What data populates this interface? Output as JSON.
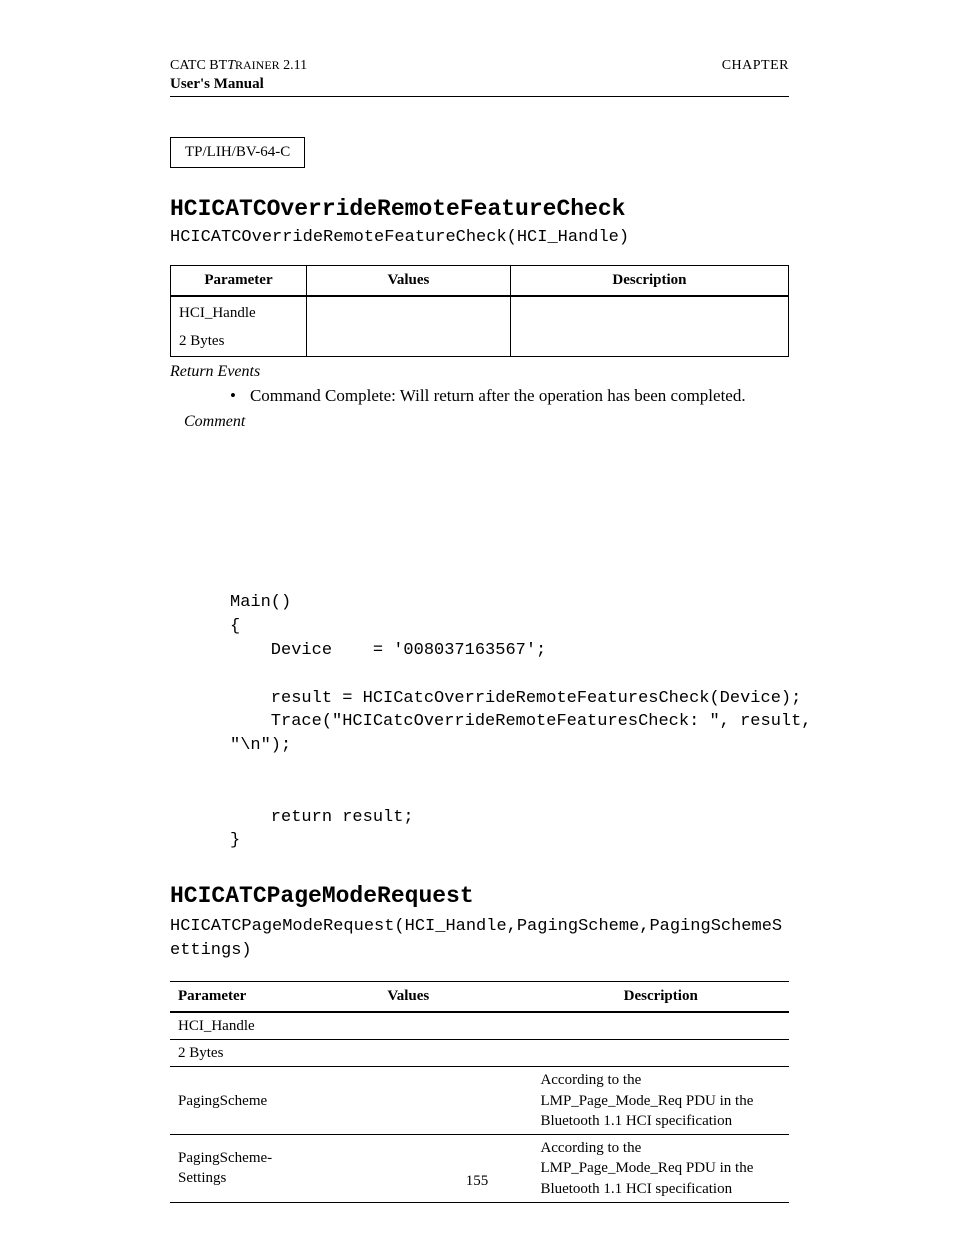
{
  "header": {
    "left_prefix": "CATC BT",
    "left_italic": "T",
    "left_smallcaps": "RAINER",
    "left_version": " 2.11",
    "right": "CHAPTER",
    "manual": "User's Manual"
  },
  "boxed_ref": "TP/LIH/BV-64-C",
  "section1": {
    "heading": "HCICATCOverrideRemoteFeatureCheck",
    "signature": "HCICATCOverrideRemoteFeatureCheck(HCI_Handle)",
    "table": {
      "headers": {
        "p": "Parameter",
        "v": "Values",
        "d": "Description"
      },
      "rows": [
        {
          "p": "HCI_Handle",
          "v": "",
          "d": ""
        },
        {
          "p": "2 Bytes",
          "v": "",
          "d": ""
        }
      ]
    },
    "return_label": "Return Events",
    "bullet": "Command Complete:  Will return after the operation has been completed.",
    "comment_label": "Comment",
    "code": "Main()\n{\n    Device    = '008037163567';\n\n    result = HCICatcOverrideRemoteFeaturesCheck(Device);\n    Trace(\"HCICatcOverrideRemoteFeaturesCheck: \", result, \n\"\\n\");\n\n\n    return result;\n}"
  },
  "section2": {
    "heading": "HCICATCPageModeRequest",
    "signature": "HCICATCPageModeRequest(HCI_Handle,PagingScheme,PagingSchemeSettings)",
    "table": {
      "headers": {
        "p": "Parameter",
        "v": "Values",
        "d": "Description"
      },
      "rows": [
        {
          "p": "HCI_Handle",
          "v": "",
          "d": ""
        },
        {
          "p": "2 Bytes",
          "v": "",
          "d": ""
        },
        {
          "p": "PagingScheme",
          "v": "",
          "d": "According to the LMP_Page_Mode_Req PDU in the Bluetooth 1.1 HCI specification"
        },
        {
          "p": "PagingScheme-Settings",
          "v": "",
          "d": "According to the LMP_Page_Mode_Req PDU in the Bluetooth 1.1 HCI specification"
        }
      ]
    }
  },
  "page_number": "155"
}
